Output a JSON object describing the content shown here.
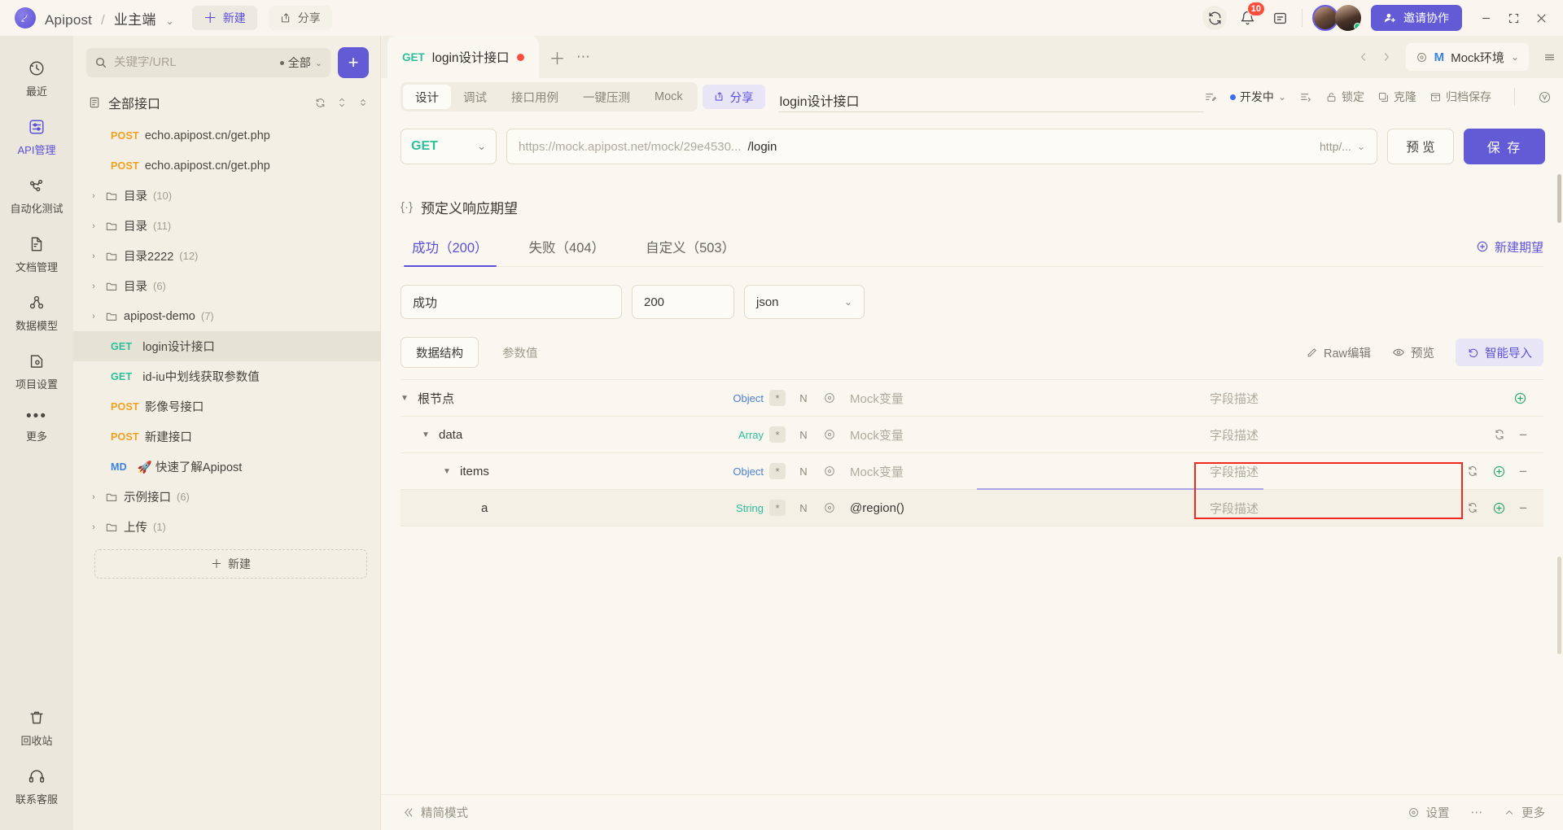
{
  "topbar": {
    "brand": "Apipost",
    "separator": "/",
    "project": "业主端",
    "new_label": "新建",
    "share_label": "分享",
    "notification_count": "10",
    "invite_label": "邀请协作"
  },
  "rail": {
    "items": [
      {
        "label": "最近",
        "icon": "clock-icon",
        "active": false
      },
      {
        "label": "API管理",
        "icon": "api-icon",
        "active": true
      },
      {
        "label": "自动化测试",
        "icon": "automation-icon",
        "active": false
      },
      {
        "label": "文档管理",
        "icon": "document-icon",
        "active": false
      },
      {
        "label": "数据模型",
        "icon": "model-icon",
        "active": false
      },
      {
        "label": "项目设置",
        "icon": "settings-icon",
        "active": false
      },
      {
        "label": "更多",
        "icon": "more-icon",
        "active": false
      }
    ],
    "bottom": [
      {
        "label": "回收站",
        "icon": "trash-icon"
      },
      {
        "label": "联系客服",
        "icon": "headset-icon"
      }
    ]
  },
  "sidebar": {
    "search_placeholder": "关键字/URL",
    "filter_label": "全部",
    "add_button": "+",
    "root_label": "全部接口",
    "new_label": "新建",
    "tree": [
      {
        "type": "api",
        "method": "POST",
        "name": "echo.apipost.cn/get.php",
        "indent": 1,
        "selected": false
      },
      {
        "type": "api",
        "method": "POST",
        "name": "echo.apipost.cn/get.php",
        "indent": 1,
        "selected": false
      },
      {
        "type": "folder",
        "name": "目录",
        "count": "(10)",
        "indent": 0,
        "selected": false
      },
      {
        "type": "folder",
        "name": "目录",
        "count": "(11)",
        "indent": 0,
        "selected": false
      },
      {
        "type": "folder",
        "name": "目录2222",
        "count": "(12)",
        "indent": 0,
        "selected": false
      },
      {
        "type": "folder",
        "name": "目录",
        "count": "(6)",
        "indent": 0,
        "selected": false
      },
      {
        "type": "folder",
        "name": "apipost-demo",
        "count": "(7)",
        "indent": 0,
        "selected": false
      },
      {
        "type": "api",
        "method": "GET",
        "name": "login设计接口",
        "indent": 1,
        "selected": true
      },
      {
        "type": "api",
        "method": "GET",
        "name": "id-iu中划线获取参数值",
        "indent": 1,
        "selected": false
      },
      {
        "type": "api",
        "method": "POST",
        "name": "影像号接口",
        "indent": 1,
        "selected": false
      },
      {
        "type": "api",
        "method": "POST",
        "name": "新建接口",
        "indent": 1,
        "selected": false
      },
      {
        "type": "api",
        "method": "MD",
        "name": "🚀 快速了解Apipost",
        "indent": 1,
        "selected": false
      },
      {
        "type": "folder",
        "name": "示例接口",
        "count": "(6)",
        "indent": 0,
        "selected": false
      },
      {
        "type": "folder",
        "name": "上传",
        "count": "(1)",
        "indent": 0,
        "selected": false
      }
    ]
  },
  "tabstrip": {
    "tab_method": "GET",
    "tab_title": "login设计接口",
    "env_name": "Mock环境",
    "env_badge": "M"
  },
  "apibar": {
    "segments": [
      {
        "label": "设计",
        "active": true
      },
      {
        "label": "调试",
        "active": false
      },
      {
        "label": "接口用例",
        "active": false
      },
      {
        "label": "一键压测",
        "active": false
      },
      {
        "label": "Mock",
        "active": false
      }
    ],
    "share_label": "分享",
    "api_name": "login设计接口",
    "status_label": "开发中",
    "meta_items": [
      "锁定",
      "克隆",
      "归档保存"
    ]
  },
  "urlrow": {
    "method": "GET",
    "host_placeholder": "https://mock.apipost.net/mock/29e4530...",
    "path": "/login",
    "protocol": "http/...",
    "preview_label": "预 览",
    "save_label": "保 存"
  },
  "content": {
    "section_title": "预定义响应期望",
    "response_tabs": [
      {
        "label": "成功（200）",
        "active": true
      },
      {
        "label": "失败（404）",
        "active": false
      },
      {
        "label": "自定义（503）",
        "active": false
      }
    ],
    "new_expect_label": "新建期望",
    "fields": {
      "name": "成功",
      "code": "200",
      "format": "json"
    },
    "struct_tabs": [
      {
        "label": "数据结构",
        "active": true
      },
      {
        "label": "参数值",
        "active": false
      }
    ],
    "raw_edit_label": "Raw编辑",
    "preview_label": "预览",
    "smart_import_label": "智能导入",
    "table": {
      "mock_placeholder": "Mock变量",
      "desc_placeholder": "字段描述",
      "required_mark": "*",
      "nullable_mark": "N",
      "rows": [
        {
          "name": "根节点",
          "type": "Object",
          "indent": 0,
          "expanded": true,
          "mock": "",
          "desc": "字段描述",
          "actions": [
            "add"
          ]
        },
        {
          "name": "data",
          "type": "Array",
          "indent": 1,
          "expanded": true,
          "mock": "",
          "desc": "字段描述",
          "actions": [
            "copy",
            "minus"
          ]
        },
        {
          "name": "items",
          "type": "Object",
          "indent": 2,
          "expanded": true,
          "mock": "",
          "desc": "字段描述",
          "actions": [
            "copy",
            "add",
            "minus"
          ]
        },
        {
          "name": "a",
          "type": "String",
          "indent": 3,
          "expanded": false,
          "mock": "@region()",
          "desc": "字段描述",
          "actions": [
            "copy",
            "add",
            "minus"
          ],
          "highlighted": true
        }
      ]
    }
  },
  "footer": {
    "simple_mode": "精简模式",
    "settings": "设置",
    "more": "更多"
  },
  "colors": {
    "accent": "#635bd6",
    "get": "#2bbf9b",
    "post": "#f0a020",
    "md": "#3a82e8",
    "danger": "#ff4d3d",
    "highlight_box": "#f02a1f"
  }
}
